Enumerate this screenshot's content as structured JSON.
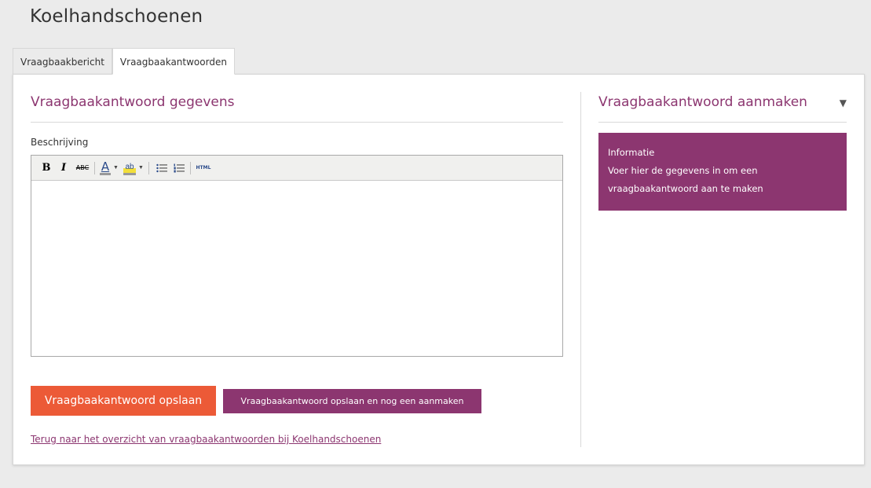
{
  "page": {
    "title": "Koelhandschoenen"
  },
  "tabs": [
    {
      "label": "Vraagbaakbericht",
      "active": false
    },
    {
      "label": "Vraagbaakantwoorden",
      "active": true
    }
  ],
  "form": {
    "section_title": "Vraagbaakantwoord gegevens",
    "description_label": "Beschrijving",
    "description_value": "",
    "toolbar": {
      "bold": "B",
      "italic": "I",
      "strikethrough": "ABC",
      "font_color": "A",
      "highlight": "ab",
      "html": "HTML"
    },
    "save_button": "Vraagbaakantwoord opslaan",
    "save_and_new_button": "Vraagbaakantwoord opslaan en nog een aanmaken",
    "back_link": "Terug naar het overzicht van vraagbaakantwoorden bij Koelhandschoenen"
  },
  "sidebar": {
    "title": "Vraagbaakantwoord aanmaken",
    "info_heading": "Informatie",
    "info_line1": "Voer hier de gegevens in om een",
    "info_line2": "vraagbaakantwoord aan te maken"
  },
  "colors": {
    "accent_purple": "#8c3670",
    "primary_orange": "#ec5a37",
    "background": "#ebebeb"
  },
  "icons": [
    "bold-icon",
    "italic-icon",
    "strikethrough-icon",
    "font-color-icon",
    "highlight-icon",
    "bullet-list-icon",
    "numbered-list-icon",
    "html-icon",
    "caret-down-icon"
  ]
}
